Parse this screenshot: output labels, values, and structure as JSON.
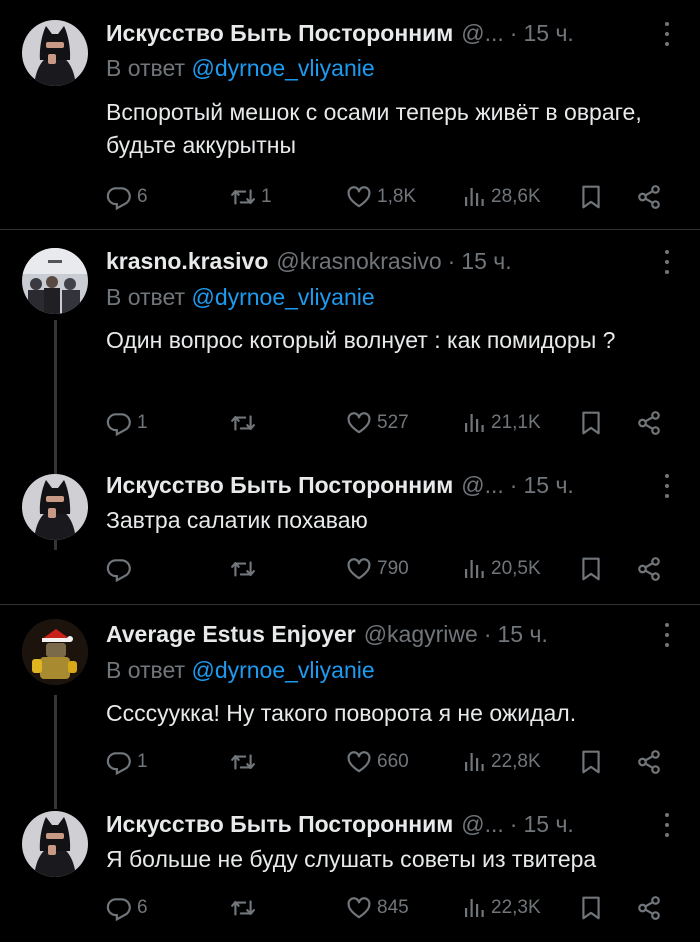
{
  "tweets": [
    {
      "name": "Искусство Быть Посторонним",
      "handle": "@...",
      "time": "15 ч.",
      "reply_prefix": "В ответ",
      "reply_to": "@dyrnoe_vliyanie",
      "text": "Вспоротый мешок с осами теперь живёт в овраге, будьте аккурытны",
      "replies": "6",
      "reposts": "1",
      "likes": "1,8K",
      "views": "28,6K"
    },
    {
      "name": "krasno.krasivo",
      "handle": "@krasnokrasivo",
      "time": "15 ч.",
      "reply_prefix": "В ответ",
      "reply_to": "@dyrnoe_vliyanie",
      "text": "Один вопрос который волнует : как помидоры ?",
      "replies": "1",
      "reposts": "",
      "likes": "527",
      "views": "21,1K"
    },
    {
      "name": "Искусство Быть Посторонним",
      "handle": "@...",
      "time": "15 ч.",
      "text": "Завтра салатик похаваю",
      "replies": "",
      "reposts": "",
      "likes": "790",
      "views": "20,5K"
    },
    {
      "name": "Average Estus Enjoyer",
      "handle": "@kagyriwe",
      "time": "15 ч.",
      "reply_prefix": "В ответ",
      "reply_to": "@dyrnoe_vliyanie",
      "text": "Ссссуукка! Ну такого поворота я не ожидал.",
      "replies": "1",
      "reposts": "",
      "likes": "660",
      "views": "22,8K"
    },
    {
      "name": "Искусство Быть Посторонним",
      "handle": "@...",
      "time": "15 ч.",
      "text": "Я больше не буду слушать советы из твитера",
      "replies": "6",
      "reposts": "",
      "likes": "845",
      "views": "22,3K"
    }
  ],
  "icons": {
    "reply": "reply-icon",
    "repost": "repost-icon",
    "like": "heart-icon",
    "views": "views-icon",
    "bookmark": "bookmark-icon",
    "share": "share-icon",
    "more": "more-icon"
  },
  "colors": {
    "background": "#000000",
    "text": "#e7e9ea",
    "muted": "#71767b",
    "link": "#1d9bf0",
    "divider": "#2f3336"
  }
}
